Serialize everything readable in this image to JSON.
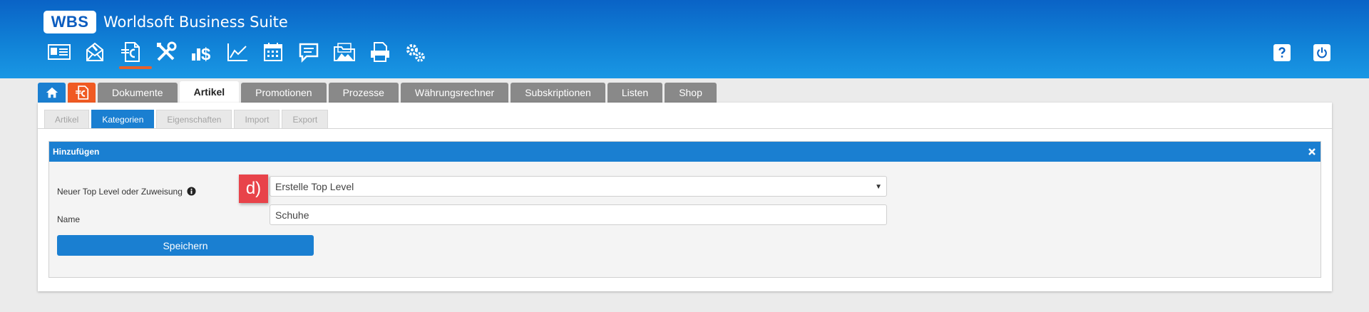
{
  "header": {
    "logo": "WBS",
    "title": "Worldsoft Business Suite",
    "toolbar": [
      "contact-card-icon",
      "mail-campaign-icon",
      "document-euro-icon",
      "tools-icon",
      "bar-chart-dollar-icon",
      "line-chart-icon",
      "calendar-icon",
      "chat-icon",
      "folder-images-icon",
      "print-document-icon",
      "settings-gears-icon"
    ],
    "active_tool": "document-euro-icon"
  },
  "tabs": [
    {
      "label": "Dokumente"
    },
    {
      "label": "Artikel",
      "active": true
    },
    {
      "label": "Promotionen"
    },
    {
      "label": "Prozesse"
    },
    {
      "label": "Währungsrechner"
    },
    {
      "label": "Subskriptionen"
    },
    {
      "label": "Listen"
    },
    {
      "label": "Shop"
    }
  ],
  "subtabs": [
    {
      "label": "Artikel"
    },
    {
      "label": "Kategorien",
      "active": true
    },
    {
      "label": "Eigenschaften"
    },
    {
      "label": "Import"
    },
    {
      "label": "Export"
    }
  ],
  "form": {
    "title": "Hinzufügen",
    "level_label": "Neuer Top Level oder Zuweisung",
    "level_value": "Erstelle Top Level",
    "name_label": "Name",
    "name_value": "Schuhe",
    "save_label": "Speichern"
  },
  "annotation": "d)",
  "colors": {
    "header": "#1184d8",
    "accent": "#1a7fd1",
    "orange": "#f05a22",
    "badge": "#e8434a"
  }
}
